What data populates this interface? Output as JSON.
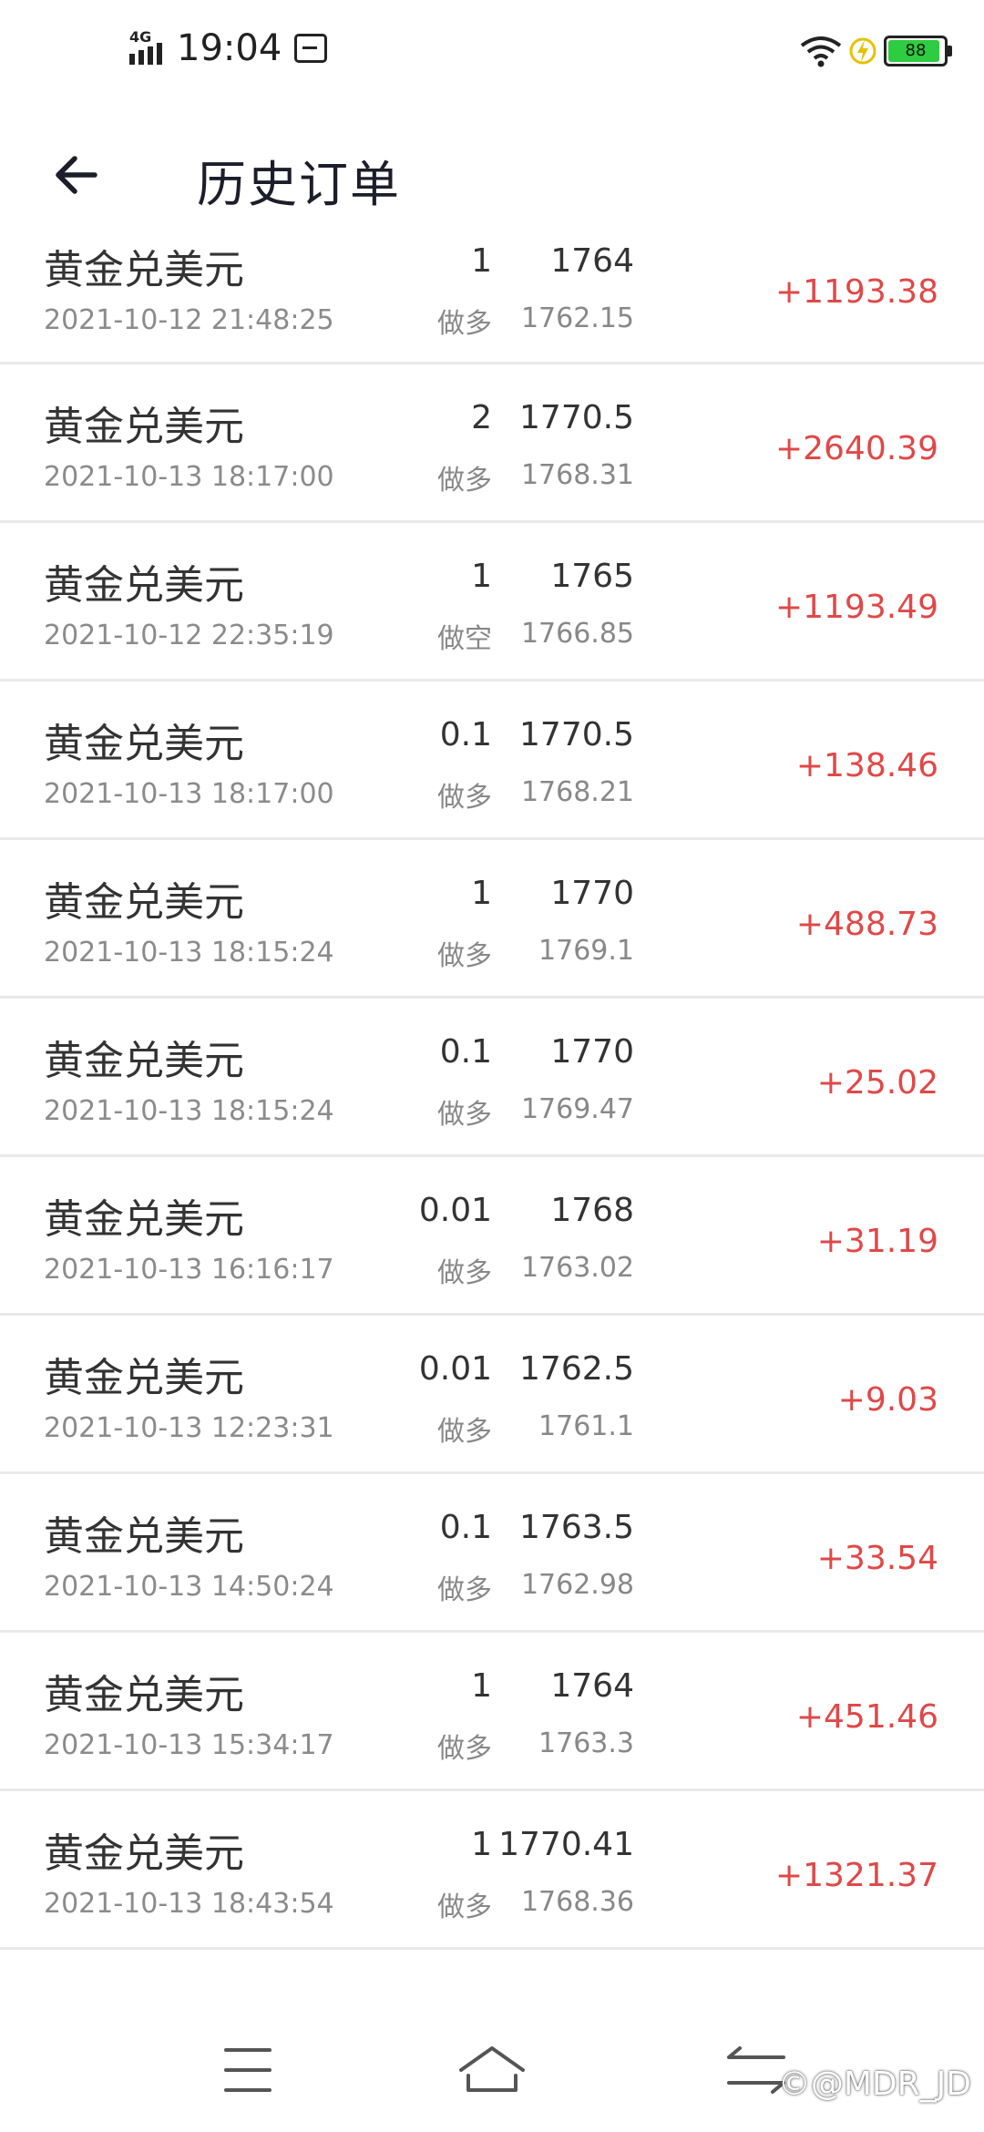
{
  "status_bar": {
    "network": "4G",
    "time": "19:04",
    "battery": "88"
  },
  "header": {
    "title": "历史订单"
  },
  "orders": [
    {
      "name": "黄金兑美元",
      "time": "2021-10-12 21:48:25",
      "qty": "1",
      "side": "做多",
      "open": "1764",
      "close": "1762.15",
      "pnl": "+1193.38"
    },
    {
      "name": "黄金兑美元",
      "time": "2021-10-13 18:17:00",
      "qty": "2",
      "side": "做多",
      "open": "1770.5",
      "close": "1768.31",
      "pnl": "+2640.39"
    },
    {
      "name": "黄金兑美元",
      "time": "2021-10-12 22:35:19",
      "qty": "1",
      "side": "做空",
      "open": "1765",
      "close": "1766.85",
      "pnl": "+1193.49"
    },
    {
      "name": "黄金兑美元",
      "time": "2021-10-13 18:17:00",
      "qty": "0.1",
      "side": "做多",
      "open": "1770.5",
      "close": "1768.21",
      "pnl": "+138.46"
    },
    {
      "name": "黄金兑美元",
      "time": "2021-10-13 18:15:24",
      "qty": "1",
      "side": "做多",
      "open": "1770",
      "close": "1769.1",
      "pnl": "+488.73"
    },
    {
      "name": "黄金兑美元",
      "time": "2021-10-13 18:15:24",
      "qty": "0.1",
      "side": "做多",
      "open": "1770",
      "close": "1769.47",
      "pnl": "+25.02"
    },
    {
      "name": "黄金兑美元",
      "time": "2021-10-13 16:16:17",
      "qty": "0.01",
      "side": "做多",
      "open": "1768",
      "close": "1763.02",
      "pnl": "+31.19"
    },
    {
      "name": "黄金兑美元",
      "time": "2021-10-13 12:23:31",
      "qty": "0.01",
      "side": "做多",
      "open": "1762.5",
      "close": "1761.1",
      "pnl": "+9.03"
    },
    {
      "name": "黄金兑美元",
      "time": "2021-10-13 14:50:24",
      "qty": "0.1",
      "side": "做多",
      "open": "1763.5",
      "close": "1762.98",
      "pnl": "+33.54"
    },
    {
      "name": "黄金兑美元",
      "time": "2021-10-13 15:34:17",
      "qty": "1",
      "side": "做多",
      "open": "1764",
      "close": "1763.3",
      "pnl": "+451.46"
    },
    {
      "name": "黄金兑美元",
      "time": "2021-10-13 18:43:54",
      "qty": "1",
      "side": "做多",
      "open": "1770.41",
      "close": "1768.36",
      "pnl": "+1321.37"
    }
  ],
  "nav": {
    "menu_icon": "menu-icon",
    "home_icon": "home-icon",
    "back_icon": "back-nav-icon"
  },
  "watermark": "©@MDR_JD",
  "colors": {
    "profit": "#e04848",
    "battery": "#2ecc40"
  }
}
